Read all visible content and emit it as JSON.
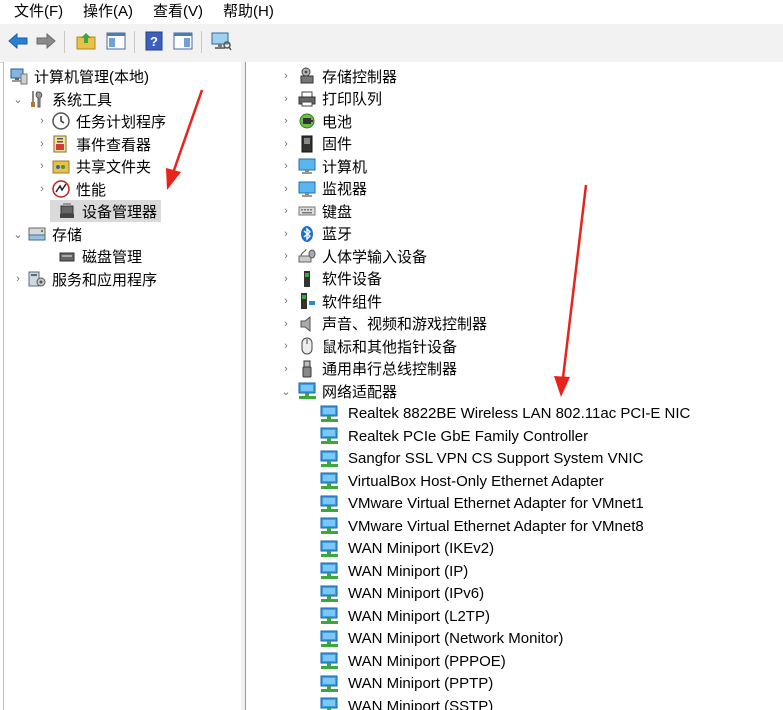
{
  "menubar": {
    "file": "文件(F)",
    "action": "操作(A)",
    "view": "查看(V)",
    "help": "帮助(H)"
  },
  "tree": {
    "root": "计算机管理(本地)",
    "system_tools": "系统工具",
    "task_scheduler": "任务计划程序",
    "event_viewer": "事件查看器",
    "shared_folders": "共享文件夹",
    "performance": "性能",
    "device_manager": "设备管理器",
    "storage": "存储",
    "disk_management": "磁盘管理",
    "services_apps": "服务和应用程序"
  },
  "devices": {
    "categories": [
      {
        "label": "存储控制器",
        "icon": "storage-controller-icon"
      },
      {
        "label": "打印队列",
        "icon": "printer-icon"
      },
      {
        "label": "电池",
        "icon": "battery-icon"
      },
      {
        "label": "固件",
        "icon": "firmware-icon"
      },
      {
        "label": "计算机",
        "icon": "computer-icon"
      },
      {
        "label": "监视器",
        "icon": "monitor-icon"
      },
      {
        "label": "键盘",
        "icon": "keyboard-icon"
      },
      {
        "label": "蓝牙",
        "icon": "bluetooth-icon"
      },
      {
        "label": "人体学输入设备",
        "icon": "hid-icon"
      },
      {
        "label": "软件设备",
        "icon": "software-device-icon"
      },
      {
        "label": "软件组件",
        "icon": "software-component-icon"
      },
      {
        "label": "声音、视频和游戏控制器",
        "icon": "sound-icon"
      },
      {
        "label": "鼠标和其他指针设备",
        "icon": "mouse-icon"
      },
      {
        "label": "通用串行总线控制器",
        "icon": "usb-icon"
      },
      {
        "label": "网络适配器",
        "icon": "network-adapter-icon"
      }
    ],
    "network_adapters": [
      "Realtek 8822BE Wireless LAN 802.11ac PCI-E NIC",
      "Realtek PCIe GbE Family Controller",
      "Sangfor SSL VPN CS Support System VNIC",
      "VirtualBox Host-Only Ethernet Adapter",
      "VMware Virtual Ethernet Adapter for VMnet1",
      "VMware Virtual Ethernet Adapter for VMnet8",
      "WAN Miniport (IKEv2)",
      "WAN Miniport (IP)",
      "WAN Miniport (IPv6)",
      "WAN Miniport (L2TP)",
      "WAN Miniport (Network Monitor)",
      "WAN Miniport (PPPOE)",
      "WAN Miniport (PPTP)",
      "WAN Miniport (SSTP)"
    ]
  },
  "colors": {
    "annotation_arrow": "#e8231c",
    "network_icon": "#1e8fd8",
    "selection": "#dadada"
  }
}
